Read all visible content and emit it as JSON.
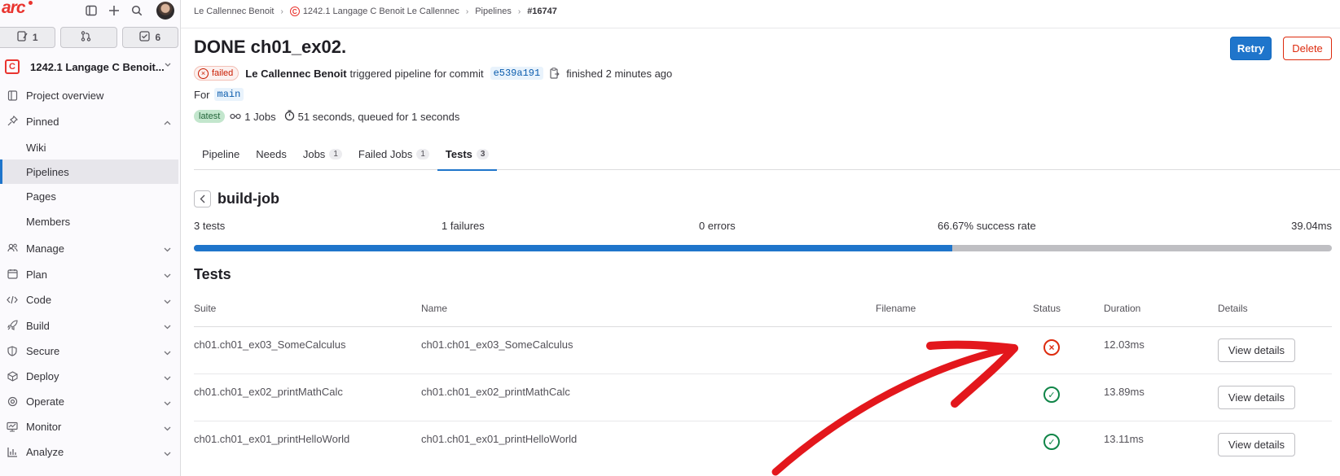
{
  "sidebar": {
    "logo_text": "arc",
    "counters": [
      {
        "icon": "issues-icon",
        "count": "1"
      },
      {
        "icon": "merge-request-icon",
        "count": ""
      },
      {
        "icon": "todo-icon",
        "count": "6"
      }
    ],
    "project": {
      "badge": "C",
      "name": "1242.1 Langage C Benoit..."
    },
    "items": [
      {
        "label": "Project overview",
        "icon": "project-icon"
      },
      {
        "label": "Pinned",
        "icon": "pin-icon"
      },
      {
        "label": "Wiki"
      },
      {
        "label": "Pipelines"
      },
      {
        "label": "Pages"
      },
      {
        "label": "Members"
      },
      {
        "label": "Manage",
        "icon": "users-icon"
      },
      {
        "label": "Plan",
        "icon": "calendar-icon"
      },
      {
        "label": "Code",
        "icon": "code-icon"
      },
      {
        "label": "Build",
        "icon": "rocket-icon"
      },
      {
        "label": "Secure",
        "icon": "shield-icon"
      },
      {
        "label": "Deploy",
        "icon": "deploy-icon"
      },
      {
        "label": "Operate",
        "icon": "operate-icon"
      },
      {
        "label": "Monitor",
        "icon": "monitor-icon"
      },
      {
        "label": "Analyze",
        "icon": "chart-icon"
      }
    ]
  },
  "breadcrumb": {
    "items": [
      "Le Callennec Benoit",
      "1242.1 Langage C Benoit Le Callennec",
      "Pipelines",
      "#16747"
    ]
  },
  "header": {
    "title": "DONE ch01_ex02.",
    "retry_label": "Retry",
    "delete_label": "Delete",
    "status": "failed",
    "author": "Le Callennec Benoit",
    "triggered_text": "triggered pipeline for commit",
    "sha": "e539a191",
    "finished_text": "finished 2 minutes ago",
    "for_label": "For",
    "ref": "main",
    "latest_label": "latest",
    "jobs_text": "1 Jobs",
    "duration_text": "51 seconds, queued for 1 seconds"
  },
  "tabs": [
    {
      "label": "Pipeline",
      "count": ""
    },
    {
      "label": "Needs",
      "count": ""
    },
    {
      "label": "Jobs",
      "count": "1"
    },
    {
      "label": "Failed Jobs",
      "count": "1"
    },
    {
      "label": "Tests",
      "count": "3"
    }
  ],
  "job": {
    "name": "build-job",
    "tests_text": "3 tests",
    "failures_text": "1 failures",
    "errors_text": "0 errors",
    "success_rate_text": "66.67% success rate",
    "time_text": "39.04ms",
    "success_rate": 0.6667
  },
  "tests_section": {
    "title": "Tests",
    "columns": [
      "Suite",
      "Name",
      "Filename",
      "Status",
      "Duration",
      "Details"
    ],
    "rows": [
      {
        "suite": "ch01.ch01_ex03_SomeCalculus",
        "name": "ch01.ch01_ex03_SomeCalculus",
        "filename": "",
        "status": "failed",
        "duration": "12.03ms",
        "details_label": "View details"
      },
      {
        "suite": "ch01.ch01_ex02_printMathCalc",
        "name": "ch01.ch01_ex02_printMathCalc",
        "filename": "",
        "status": "success",
        "duration": "13.89ms",
        "details_label": "View details"
      },
      {
        "suite": "ch01.ch01_ex01_printHelloWorld",
        "name": "ch01.ch01_ex01_printHelloWorld",
        "filename": "",
        "status": "success",
        "duration": "13.11ms",
        "details_label": "View details"
      }
    ]
  },
  "colors": {
    "accent": "#1f75cb",
    "danger": "#dd2b0e",
    "success": "#108548",
    "annotation_arrow": "#e3171c"
  }
}
